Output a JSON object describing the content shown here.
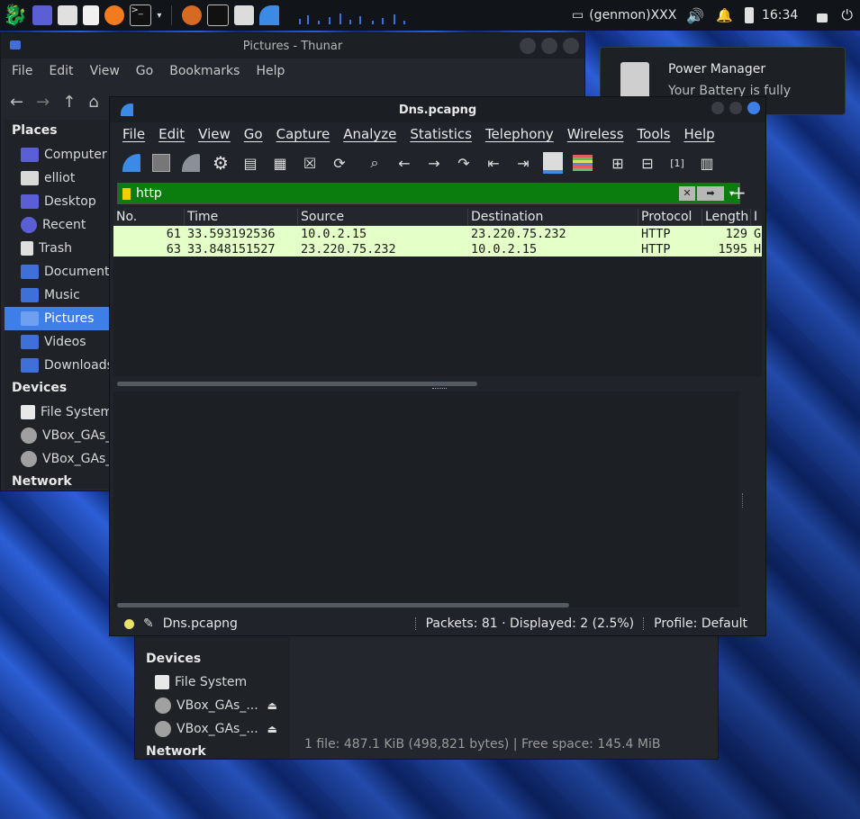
{
  "panel": {
    "genmon": "(genmon)XXX",
    "clock": "16:34"
  },
  "thunar": {
    "title": "Pictures - Thunar",
    "menu": [
      "File",
      "Edit",
      "View",
      "Go",
      "Bookmarks",
      "Help"
    ],
    "places_header": "Places",
    "places": [
      {
        "label": "Computer",
        "icon": "computer-icon",
        "color": "#5a5fd6"
      },
      {
        "label": "elliot",
        "icon": "home-folder-icon",
        "color": "#d9d9d9"
      },
      {
        "label": "Desktop",
        "icon": "desktop-folder-icon",
        "color": "#5a5fd6"
      },
      {
        "label": "Recent",
        "icon": "recent-icon",
        "color": "#5a5fd6"
      },
      {
        "label": "Trash",
        "icon": "trash-icon",
        "color": "#e0e0e0"
      },
      {
        "label": "Documents",
        "icon": "documents-folder-icon",
        "color": "#3f6fd8"
      },
      {
        "label": "Music",
        "icon": "music-folder-icon",
        "color": "#3f6fd8"
      },
      {
        "label": "Pictures",
        "icon": "pictures-folder-icon",
        "color": "#3f6fd8"
      },
      {
        "label": "Videos",
        "icon": "videos-folder-icon",
        "color": "#3f6fd8"
      },
      {
        "label": "Downloads",
        "icon": "downloads-folder-icon",
        "color": "#3f6fd8"
      }
    ],
    "devices_header": "Devices",
    "devices": [
      {
        "label": "File System",
        "icon": "drive-icon"
      },
      {
        "label": "VBox_GAs_",
        "icon": "cdrom-icon"
      },
      {
        "label": "VBox_GAs_",
        "icon": "cdrom-icon"
      }
    ],
    "network_header": "Network",
    "lower_devices_header": "Devices",
    "lower_devices": [
      {
        "label": "File System",
        "icon": "drive-icon"
      },
      {
        "label": "VBox_GAs_...",
        "icon": "cdrom-icon"
      },
      {
        "label": "VBox_GAs_...",
        "icon": "cdrom-icon"
      }
    ],
    "lower_network_header": "Network",
    "status": "1 file: 487.1 KiB (498,821 bytes) | Free space: 145.4 MiB"
  },
  "notification": {
    "title": "Power Manager",
    "message": "Your Battery is fully charged"
  },
  "wireshark": {
    "title": "Dns.pcapng",
    "menu": [
      "File",
      "Edit",
      "View",
      "Go",
      "Capture",
      "Analyze",
      "Statistics",
      "Telephony",
      "Wireless",
      "Tools",
      "Help"
    ],
    "filter": "http",
    "columns": [
      "No.",
      "Time",
      "Source",
      "Destination",
      "Protocol",
      "Length",
      "I"
    ],
    "rows": [
      {
        "no": "61",
        "time": "33.593192536",
        "source": "10.0.2.15",
        "destination": "23.220.75.232",
        "protocol": "HTTP",
        "length": "129",
        "info": "G"
      },
      {
        "no": "63",
        "time": "33.848151527",
        "source": "23.220.75.232",
        "destination": "10.0.2.15",
        "protocol": "HTTP",
        "length": "1595",
        "info": "H"
      }
    ],
    "status_file": "Dns.pcapng",
    "status_packets": "Packets: 81 · Displayed: 2 (2.5%)",
    "status_profile": "Profile: Default"
  }
}
